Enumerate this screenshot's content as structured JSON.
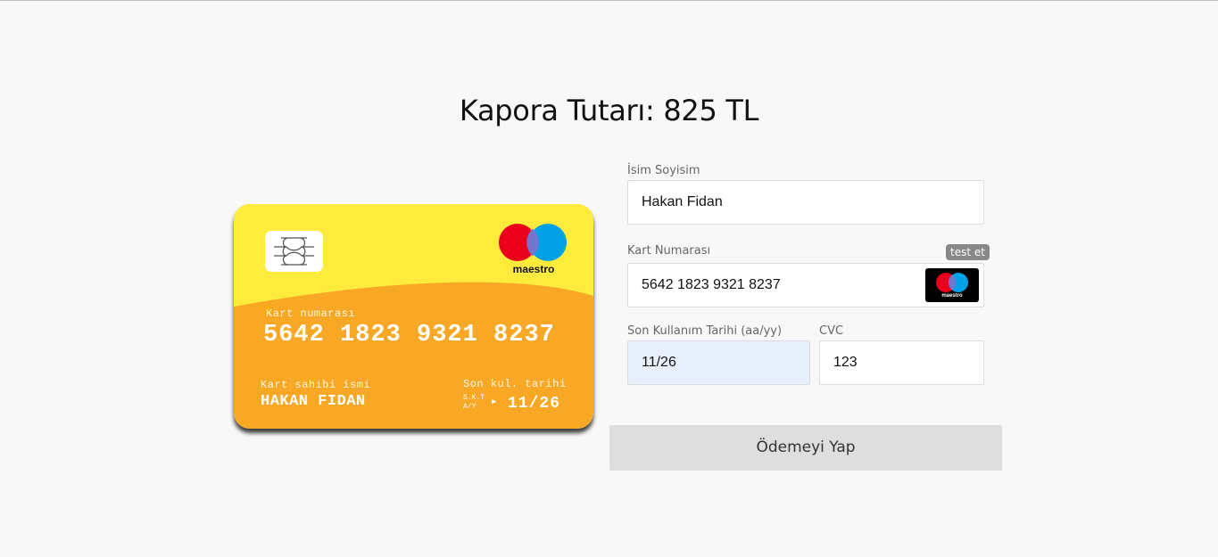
{
  "page_title": "Kapora Tutarı: 825 TL",
  "card": {
    "brand_icon": "maestro-logo",
    "brand_text": "maestro",
    "number_label": "Kart numarası",
    "number": "5642 1823 9321 8237",
    "holder_label": "Kart sahibi ismi",
    "holder": "HAKAN FIDAN",
    "expiry_label": "Son kul. tarihi",
    "expiry_small_1": "S.K.T",
    "expiry_small_2": "A/Y",
    "expiry_arrow": "▶",
    "expiry": "11/26",
    "colors": {
      "top": "#ffeb3b",
      "bottom": "#f9a825",
      "mc_red": "#eb001b",
      "mc_blue": "#00a2e5",
      "mc_overlap": "#7375cf"
    }
  },
  "form": {
    "name": {
      "label": "İsim Soyisim",
      "value": "Hakan Fidan"
    },
    "card_number": {
      "label": "Kart Numarası",
      "value": "5642 1823 9321 8237",
      "test_button": "test et",
      "brand_text": "maestro"
    },
    "expiry": {
      "label": "Son Kullanım Tarihi (aa/yy)",
      "value": "11/26"
    },
    "cvc": {
      "label": "CVC",
      "value": "123"
    },
    "submit": "Ödemeyi Yap"
  }
}
